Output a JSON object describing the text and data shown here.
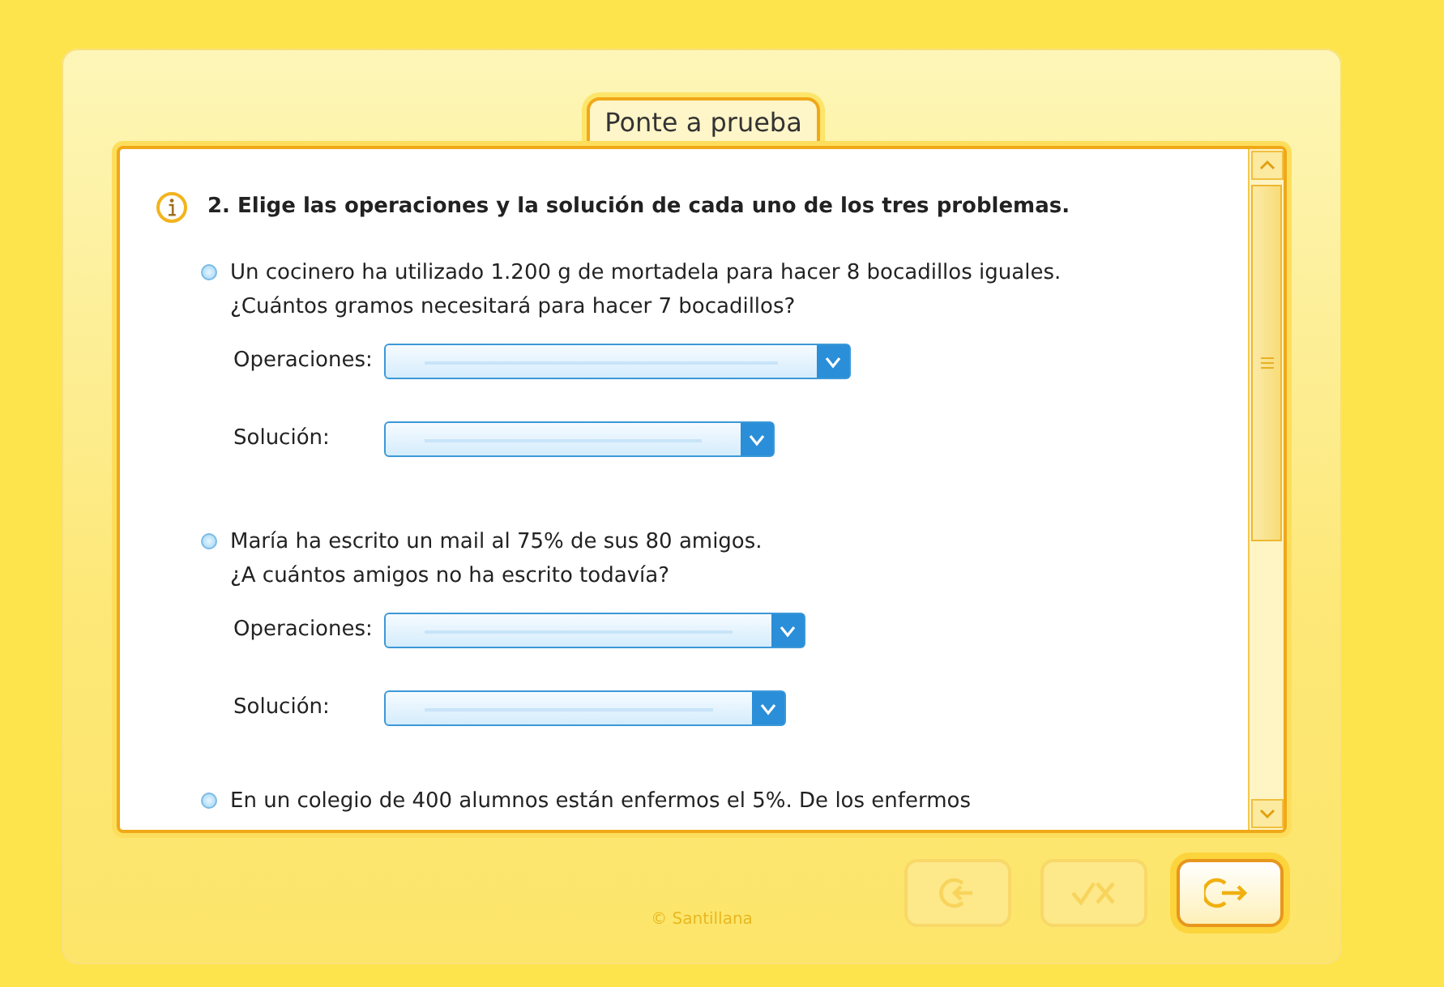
{
  "tab": {
    "label": "Ponte a prueba",
    "selected": true
  },
  "instruction": {
    "text": "2. Elige las operaciones y la solución de cada uno de los tres problemas."
  },
  "problems": [
    {
      "lines": [
        "Un cocinero ha utilizado 1.200 g de mortadela para hacer 8 bocadillos iguales.",
        "¿Cuántos gramos necesitará para hacer 7 bocadillos?"
      ],
      "fields": [
        {
          "label": "Operaciones:"
        },
        {
          "label": "Solución:"
        }
      ]
    },
    {
      "lines": [
        "María ha escrito un mail al 75% de sus 80 amigos.",
        "¿A cuántos amigos no ha escrito todavía?"
      ],
      "fields": [
        {
          "label": "Operaciones:"
        },
        {
          "label": "Solución:"
        }
      ]
    },
    {
      "lines": [
        "En un colegio de 400 alumnos están enfermos el 5%. De los enfermos"
      ]
    }
  ],
  "buttons": [
    {
      "kind": "back",
      "disabled": true
    },
    {
      "kind": "check",
      "disabled": true
    },
    {
      "kind": "next",
      "disabled": false
    }
  ],
  "footer": "© Santillana"
}
